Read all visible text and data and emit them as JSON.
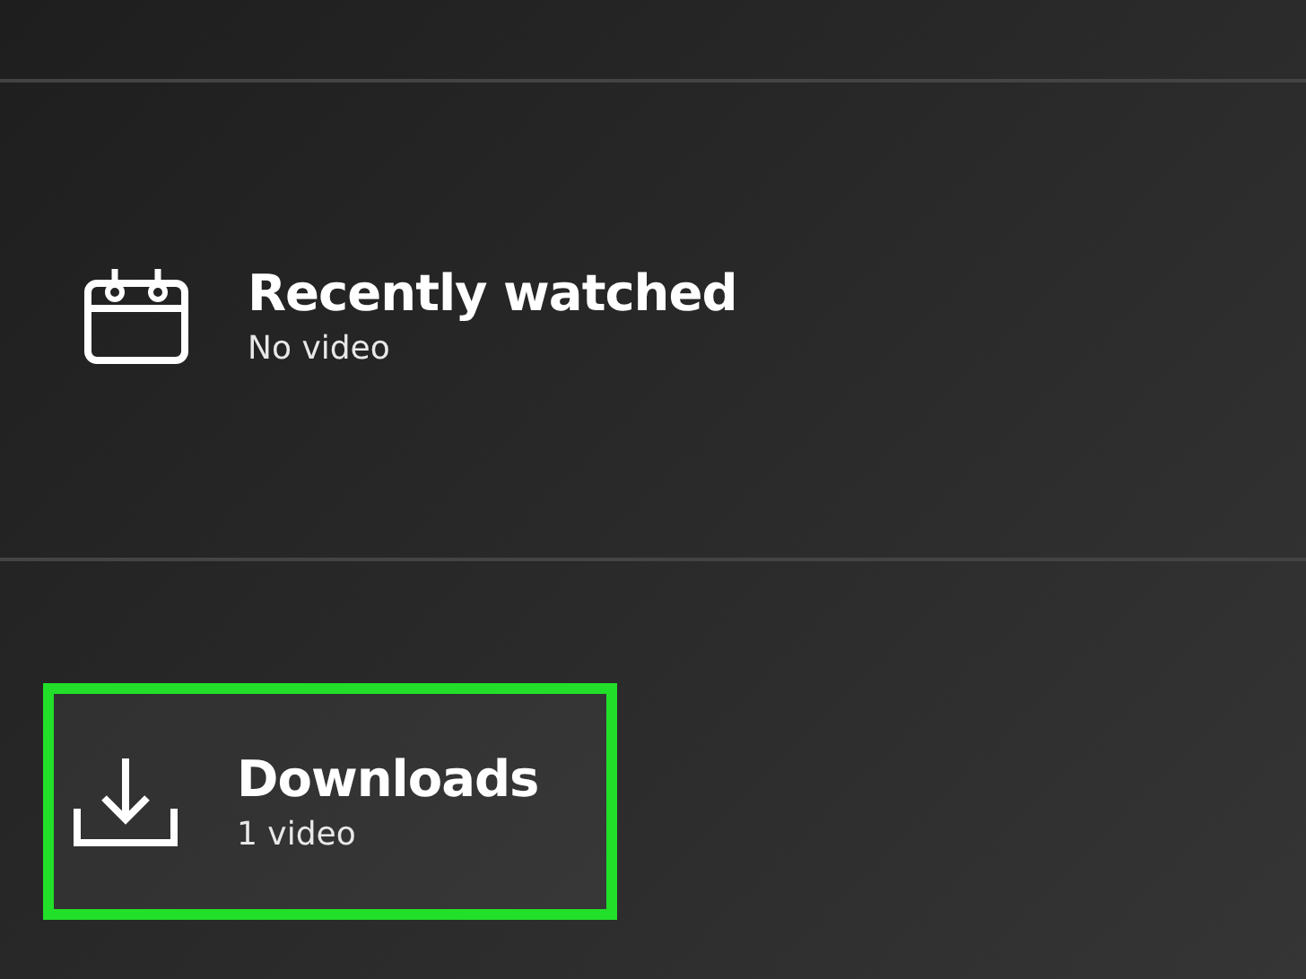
{
  "items": [
    {
      "kind": "calendar",
      "title": "Recently watched",
      "subtitle": "No video",
      "highlighted": false
    },
    {
      "kind": "download",
      "title": "Downloads",
      "subtitle": "1 video",
      "highlighted": true
    }
  ]
}
